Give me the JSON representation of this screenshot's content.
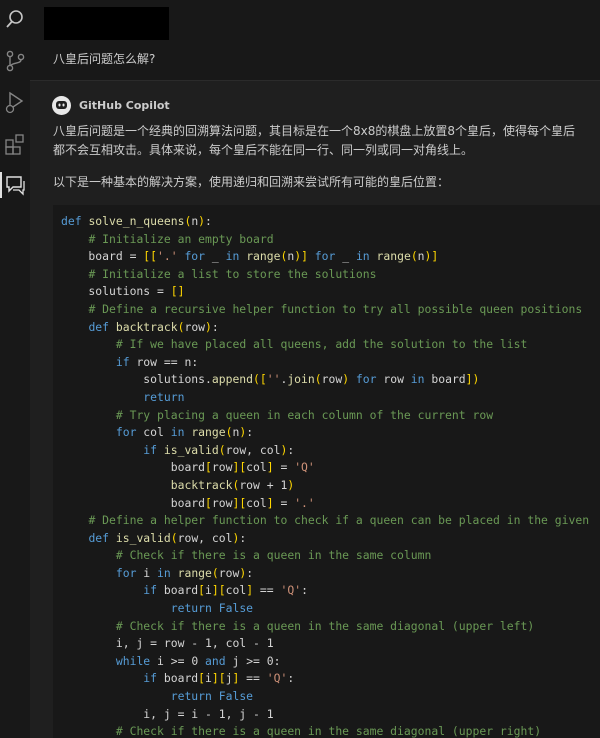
{
  "activity_bar": {
    "icons": [
      "search-icon",
      "source-control-icon",
      "run-debug-icon",
      "extensions-icon",
      "chat-icon"
    ],
    "active": "chat-icon"
  },
  "chat": {
    "user_message": "八皇后问题怎么解?",
    "assistant_name": "GitHub Copilot",
    "intro": "八皇后问题是一个经典的回溯算法问题，其目标是在一个8x8的棋盘上放置8个皇后，使得每个皇后都不会互相攻击。具体来说，每个皇后不能在同一行、同一列或同一对角线上。",
    "approach": "以下是一种基本的解决方案，使用递归和回溯来尝试所有可能的皇后位置：",
    "code_lines": [
      "def solve_n_queens(n):",
      "    # Initialize an empty board",
      "    board = [['.' for _ in range(n)] for _ in range(n)]",
      "    # Initialize a list to store the solutions",
      "    solutions = []",
      "    # Define a recursive helper function to try all possible queen positions",
      "    def backtrack(row):",
      "        # If we have placed all queens, add the solution to the list",
      "        if row == n:",
      "            solutions.append([''.join(row) for row in board])",
      "            return",
      "        # Try placing a queen in each column of the current row",
      "        for col in range(n):",
      "            if is_valid(row, col):",
      "                board[row][col] = 'Q'",
      "                backtrack(row + 1)",
      "                board[row][col] = '.'",
      "    # Define a helper function to check if a queen can be placed in the given",
      "    def is_valid(row, col):",
      "        # Check if there is a queen in the same column",
      "        for i in range(row):",
      "            if board[i][col] == 'Q':",
      "                return False",
      "        # Check if there is a queen in the same diagonal (upper left)",
      "        i, j = row - 1, col - 1",
      "        while i >= 0 and j >= 0:",
      "            if board[i][j] == 'Q':",
      "                return False",
      "            i, j = i - 1, j - 1",
      "        # Check if there is a queen in the same diagonal (upper right)"
    ]
  },
  "colors": {
    "background": "#1f1f1f",
    "code_background": "#181818",
    "keyword": "#569cd6",
    "function": "#dcdcaa",
    "comment": "#6a9955",
    "string": "#ce9178"
  }
}
